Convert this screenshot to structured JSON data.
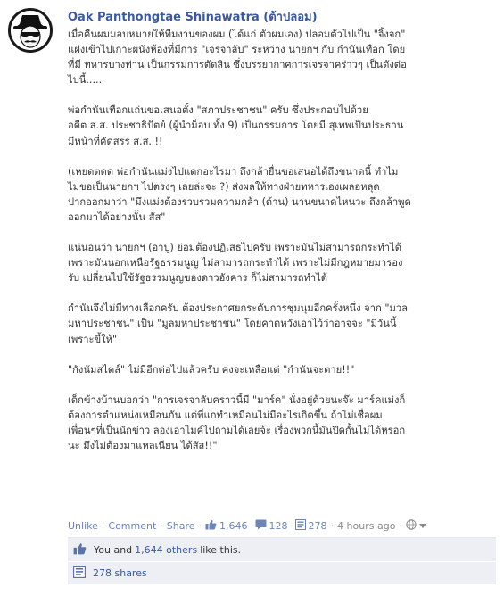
{
  "post": {
    "author": "Oak Panthongtae Shinawatra (ต้าปลอม)",
    "paragraphs": [
      [
        "เมื่อคืนผมมอบหมายให้ทีมงานของผม (ได้แก่ ตัวผมเอง) ปลอมตัวไปเป็น \"จิ้งจก\"",
        "แฝงเข้าไปเกาะผนังห้องที่มีการ \"เจรจาลับ\" ระหว่าง นายกฯ กับ กำนันเทือก โดย",
        "ที่มี ทหารบางท่าน เป็นกรรมการตัดสิน ซึ่งบรรยากาศการเจรจาคร่าวๆ เป็นดังต่อ",
        "ไปนี้....."
      ],
      [
        "พ่อกำนันเทือกแถ่นขอเสนอตั้ง \"สภาประชาชน\" ครับ ซึ่งประกอบไปด้วย",
        "อดีต ส.ส. ประชาธิปัตย์ (ผู้นำม็อบ ทั้ง 9) เป็นกรรมการ โดยมี สุเทพเป็นประธาน",
        "มีหน้าที่คัดสรร ส.ส. !!"
      ],
      [
        "(เหยดตดด พ่อกำนันแม่งไปแดกอะไรมา ถึงกล้ายื่นขอเสนอได้ถึงขนาดนี้ ทำไม",
        "ไม่ขอเป็นนายกฯ ไปตรงๆ เลยล่ะจะ ?) ส่งผลให้ทางฝ่ายทหารเองเผลอหลุด",
        "ปากออกมาว่า \"มึงแม่งต้องรวบรวมความกล้า (ด้าน) นานขนาดไหนวะ ถึงกล้าพูด",
        "ออกมาได้อย่างนั้น สัส\""
      ],
      [
        "แน่นอนว่า นายกฯ (อาปู) ย่อมต้องปฏิเสธไปครับ เพราะมันไม่สามารถกระทำได้",
        "เพราะมันนอกเหนือรัฐธรรมนูญ ไม่สามารถกระทำได้ เพราะไม่มีกฎหมายมารอง",
        "รับ เปลี่ยนไปใช้รัฐธรรมนูญของดาวอังคาร ก็ไม่สามารถทำได้"
      ],
      [
        "กำนันจึงไม่มีทางเลือกครับ ต้องประกาศยกระดับการชุมนุมอีกครั้งหนึ่ง จาก \"มวล",
        "มหาประชาชน\" เป็น \"มูลมหาประชาชน\" โดยคาดหวังเอาไว้ว่าอาจจะ \"มีวันนี้",
        "เพราะขี้ให้\""
      ],
      [
        "\"กังนัมสไตล์\" ไม่มีอีกต่อไปแล้วครับ คงจะเหลือแต่ \"กำนันจะตาย!!\""
      ],
      [
        "เด็กข้างบ้านบอกว่า \"การเจรจาลับคราวนี้มี \"มาร์ค\" นั่งอยู่ด้วยนะจ๊ะ มาร์คแม่งก็",
        "ต้องการตำแหน่งเหมือนกัน แต่พี่แกทำเหมือนไม่มีอะไรเกิดขึ้น ถ้าไม่เชื่อผม",
        "เพื่อนๆที่เป็นนักข่าว ลองเอาไมค์ไปถามได้เลยจ้ะ เรื่องพวกนี้มันปิดกั้นไม่ได้หรอก",
        "นะ มึงไม่ต้องมาแหลเนียน ได้สัส!!\""
      ]
    ]
  },
  "actions": {
    "unlike": "Unlike",
    "comment": "Comment",
    "share": "Share",
    "likes_count": "1,646",
    "comments_count": "128",
    "shares_count": "278",
    "time": "4 hours ago"
  },
  "ufi": {
    "likes_prefix": "You and ",
    "likes_others": "1,644 others",
    "likes_suffix": " like this.",
    "shares_text": "278 shares"
  },
  "icons": {
    "avatar": "avatar-image",
    "like": "thumbs-up-icon",
    "comment": "comment-icon",
    "share": "share-icon",
    "globe": "globe-icon",
    "chevron": "chevron-down-icon"
  },
  "colors": {
    "link": "#3b5998",
    "action_link": "#6d84b4",
    "ufi_bg": "#edeff4"
  }
}
